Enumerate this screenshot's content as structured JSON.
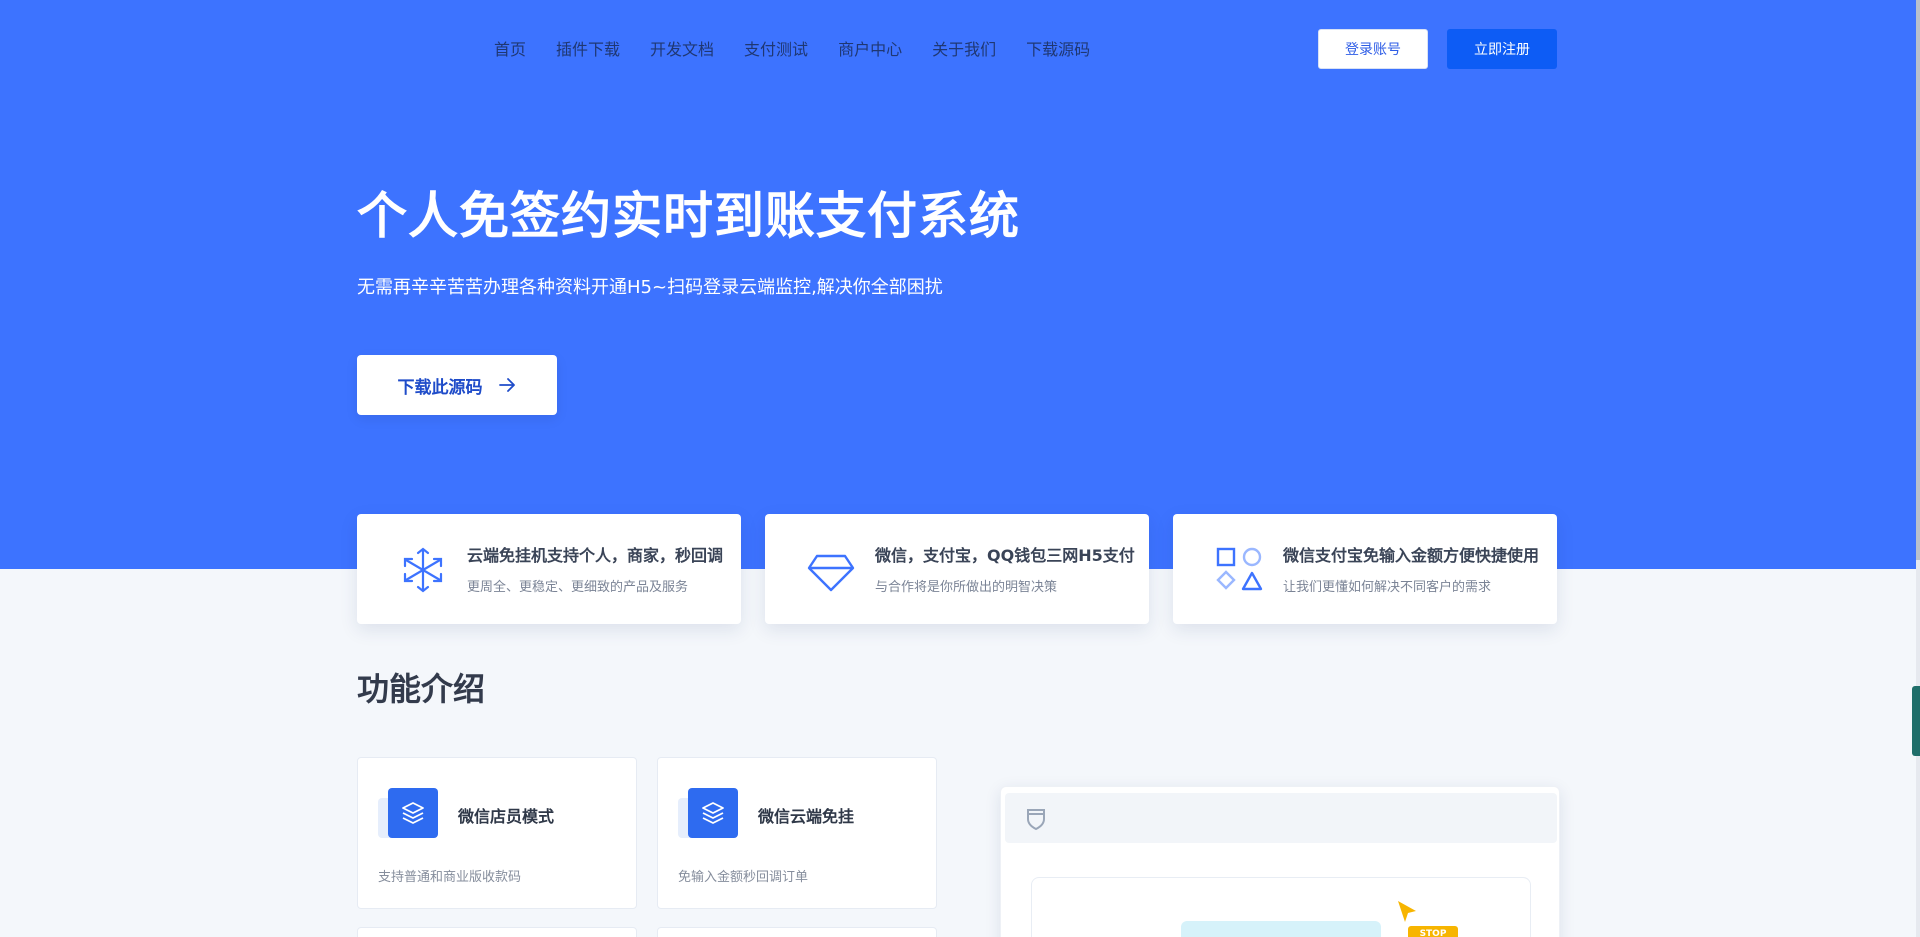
{
  "nav": {
    "links": [
      "首页",
      "插件下载",
      "开发文档",
      "支付测试",
      "商户中心",
      "关于我们",
      "下载源码"
    ],
    "login_label": "登录账号",
    "register_label": "立即注册"
  },
  "hero": {
    "title": "个人免签约实时到账支付系统",
    "subtitle": "无需再辛辛苦苦办理各种资料开通H5~扫码登录云端监控,解决你全部困扰",
    "download_label": "下载此源码"
  },
  "features": [
    {
      "title": "云端免挂机支持个人，商家，秒回调",
      "desc": "更周全、更稳定、更细致的产品及服务",
      "icon": "snowflake-icon"
    },
    {
      "title": "微信，支付宝，QQ钱包三网H5支付",
      "desc": "与合作将是你所做出的明智决策",
      "icon": "diamond-icon"
    },
    {
      "title": "微信支付宝免输入金额方便快捷使用",
      "desc": "让我们更懂如何解决不同客户的需求",
      "icon": "shapes-icon"
    }
  ],
  "section": {
    "title": "功能介绍"
  },
  "function_cards": [
    {
      "title": "微信店员模式",
      "desc": "支持普通和商业版收款码",
      "icon": "layers-icon"
    },
    {
      "title": "微信云端免挂",
      "desc": "免输入金额秒回调订单",
      "icon": "layers-icon"
    }
  ],
  "preview": {
    "stop_label": "STOP"
  },
  "colors": {
    "hero_bg": "#3d73ff",
    "accent": "#0d5cf5",
    "page_bg": "#f4f7fb"
  }
}
